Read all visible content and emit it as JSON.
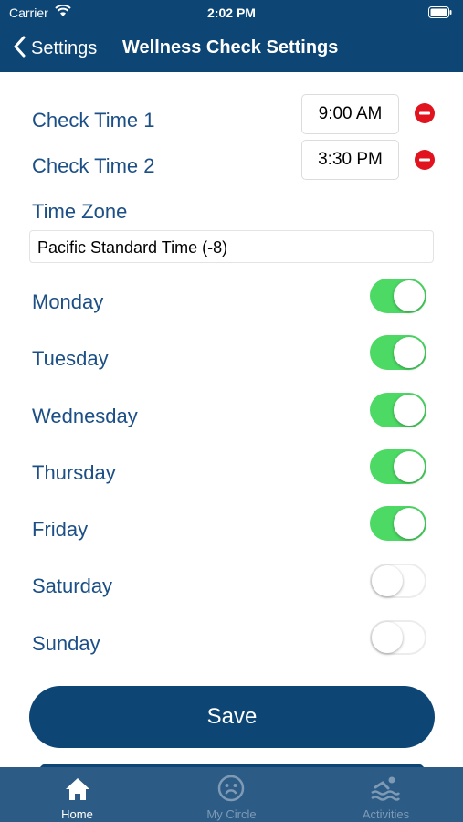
{
  "status_bar": {
    "carrier": "Carrier",
    "time": "2:02 PM"
  },
  "nav": {
    "back_label": "Settings",
    "title": "Wellness Check Settings"
  },
  "check_times": [
    {
      "label": "Check Time 1",
      "value": "9:00 AM"
    },
    {
      "label": "Check Time 2",
      "value": "3:30 PM"
    }
  ],
  "time_zone": {
    "label": "Time Zone",
    "value": "Pacific Standard Time (-8)"
  },
  "days": [
    {
      "label": "Monday",
      "enabled": true
    },
    {
      "label": "Tuesday",
      "enabled": true
    },
    {
      "label": "Wednesday",
      "enabled": true
    },
    {
      "label": "Thursday",
      "enabled": true
    },
    {
      "label": "Friday",
      "enabled": true
    },
    {
      "label": "Saturday",
      "enabled": false
    },
    {
      "label": "Sunday",
      "enabled": false
    }
  ],
  "save_label": "Save",
  "tabs": [
    {
      "label": "Home",
      "icon": "home-icon",
      "active": true
    },
    {
      "label": "My Circle",
      "icon": "face-icon",
      "active": false
    },
    {
      "label": "Activities",
      "icon": "swimmer-icon",
      "active": false
    }
  ],
  "colors": {
    "header": "#0d4575",
    "label_text": "#1b4f86",
    "toggle_on": "#4cd964",
    "remove": "#e0131f",
    "tabbar": "#2c5b85"
  }
}
